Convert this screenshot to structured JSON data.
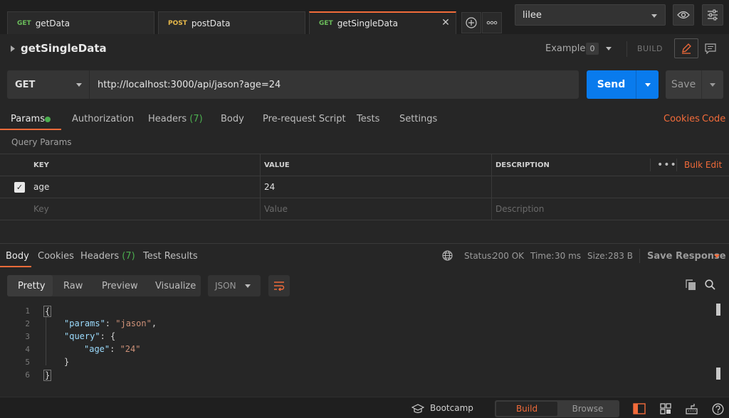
{
  "tabs": [
    {
      "method": "GET",
      "name": "getData"
    },
    {
      "method": "POST",
      "name": "postData"
    },
    {
      "method": "GET",
      "name": "getSingleData"
    }
  ],
  "env": {
    "selected": "lilee"
  },
  "request": {
    "title": "getSingleData",
    "examples_label": "Examples",
    "examples_count": "0",
    "build_label": "BUILD",
    "method": "GET",
    "url": "http://localhost:3000/api/jason?age=24",
    "send_label": "Send",
    "save_label": "Save"
  },
  "req_tabs": {
    "params": "Params",
    "authorization": "Authorization",
    "headers": "Headers",
    "headers_count": "(7)",
    "body": "Body",
    "prerequest": "Pre-request Script",
    "tests": "Tests",
    "settings": "Settings",
    "cookies": "Cookies",
    "code": "Code"
  },
  "query_params": {
    "label": "Query Params",
    "columns": {
      "key": "KEY",
      "value": "VALUE",
      "description": "DESCRIPTION"
    },
    "bulk_edit": "Bulk Edit",
    "rows": [
      {
        "key": "age",
        "value": "24",
        "checked": true
      }
    ],
    "placeholders": {
      "key": "Key",
      "value": "Value",
      "description": "Description"
    }
  },
  "response": {
    "tabs": {
      "body": "Body",
      "cookies": "Cookies",
      "headers": "Headers",
      "headers_count": "(7)",
      "tests": "Test Results"
    },
    "status_label": "Status:",
    "status_value": "200 OK",
    "time_label": "Time:",
    "time_value": "30 ms",
    "size_label": "Size:",
    "size_value": "283 B",
    "save_response": "Save Response",
    "formats": {
      "pretty": "Pretty",
      "raw": "Raw",
      "preview": "Preview",
      "visualize": "Visualize"
    },
    "lang": "JSON",
    "code_lines": [
      "1",
      "2",
      "3",
      "4",
      "5",
      "6"
    ],
    "json": {
      "key_params": "\"params\"",
      "val_params": "\"jason\"",
      "key_query": "\"query\"",
      "key_age": "\"age\"",
      "val_age": "\"24\""
    }
  },
  "footer": {
    "bootcamp": "Bootcamp",
    "build": "Build",
    "browse": "Browse"
  },
  "colors": {
    "accent": "#f26b3a",
    "send": "#097bed",
    "success": "#4cae4f"
  }
}
